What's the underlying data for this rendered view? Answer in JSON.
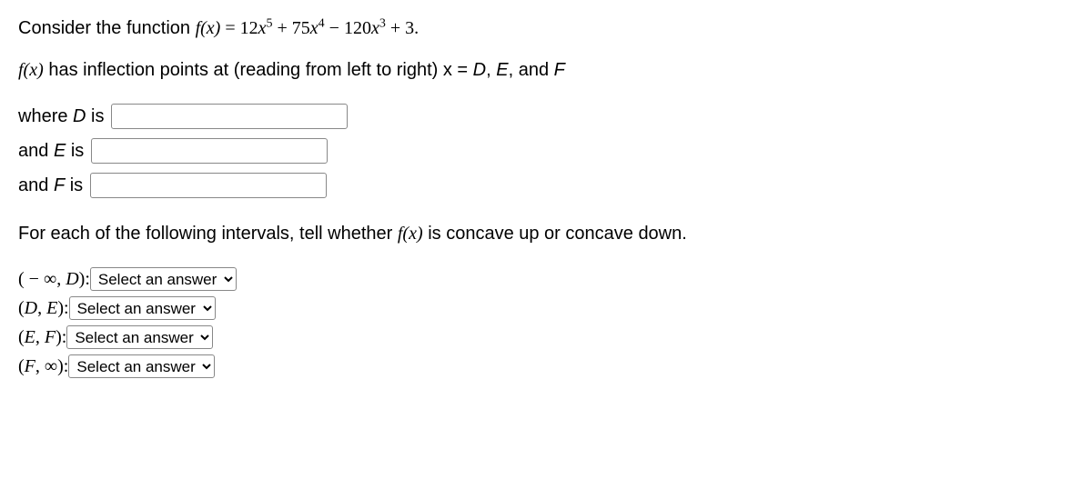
{
  "line1_prefix": "Consider the function ",
  "function_def": "f(x) = 12x⁵ + 75x⁴ − 120x³ + 3.",
  "line2_part1": "f(x)",
  "line2_part2": " has inflection points at (reading from left to right) x = ",
  "line2_part3": "D",
  "line2_part4": ", ",
  "line2_part5": "E",
  "line2_part6": ", and ",
  "line2_part7": "F",
  "inputs": {
    "d_label_pre": "where ",
    "d_label_var": "D",
    "d_label_post": " is",
    "e_label_pre": "and ",
    "e_label_var": "E",
    "e_label_post": " is",
    "f_label_pre": "and ",
    "f_label_var": "F",
    "f_label_post": " is"
  },
  "concavity_prompt_pre": "For each of the following intervals, tell whether ",
  "concavity_prompt_fx": "f(x)",
  "concavity_prompt_post": " is concave up or concave down.",
  "intervals": {
    "i1": "( − ∞, D): ",
    "i2": "(D, E): ",
    "i3": "(E, F): ",
    "i4": "(F, ∞): "
  },
  "select_placeholder": "Select an answer"
}
